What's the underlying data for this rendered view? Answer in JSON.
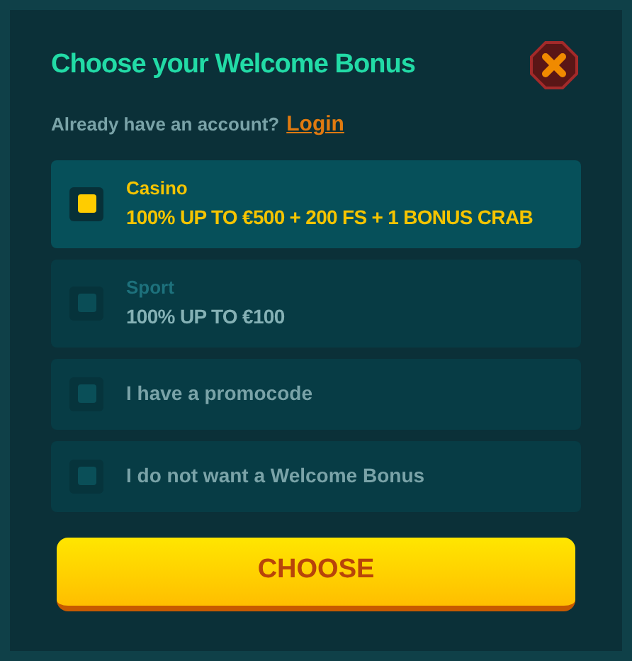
{
  "title": "Choose your Welcome Bonus",
  "account_prompt": {
    "text": "Already have an account?",
    "link": "Login"
  },
  "options": [
    {
      "kind": "bonus",
      "label": "Casino",
      "offer": "100% UP TO €500 + 200 FS + 1 BONUS CRAB",
      "selected": true,
      "disabled": false
    },
    {
      "kind": "bonus",
      "label": "Sport",
      "offer": "100% UP TO €100",
      "selected": false,
      "disabled": true
    },
    {
      "kind": "simple",
      "label": "I have a promocode",
      "selected": false,
      "disabled": false
    },
    {
      "kind": "simple",
      "label": "I do not want a Welcome Bonus",
      "selected": false,
      "disabled": false
    }
  ],
  "button": "CHOOSE"
}
